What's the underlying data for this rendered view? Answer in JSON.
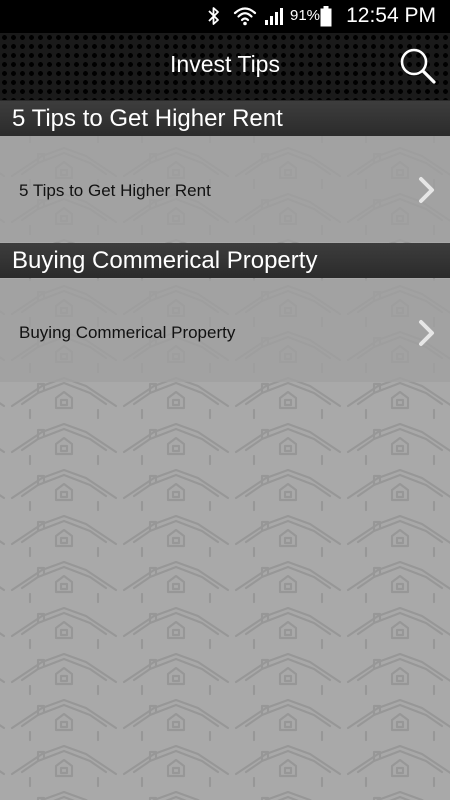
{
  "status_bar": {
    "battery_percent": "91%",
    "time": "12:54 PM",
    "icons": [
      "bluetooth-icon",
      "wifi-icon",
      "signal-icon",
      "battery-icon"
    ]
  },
  "app_bar": {
    "title": "Invest Tips",
    "search_icon": "search-icon"
  },
  "sections": [
    {
      "header": "5 Tips to Get Higher Rent",
      "items": [
        {
          "label": "5 Tips to Get Higher Rent",
          "icon": "chevron-right-icon"
        }
      ]
    },
    {
      "header": "Buying Commerical Property",
      "items": [
        {
          "label": "Buying Commerical Property",
          "icon": "chevron-right-icon"
        }
      ]
    }
  ],
  "colors": {
    "status_bar_bg": "#000000",
    "app_bar_bg": "#1a1a1a",
    "section_header_bg": "#333333",
    "list_bg": "#a9a9a9",
    "chevron": "#e0e0e0"
  }
}
